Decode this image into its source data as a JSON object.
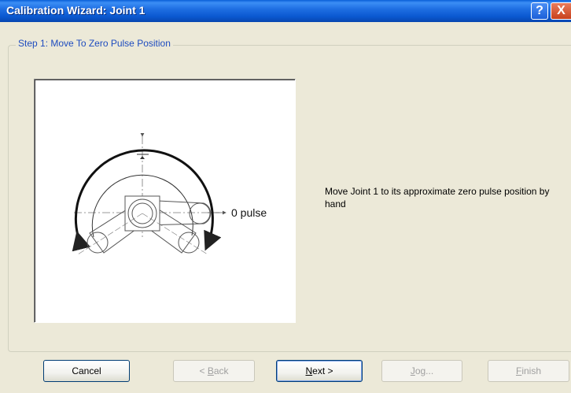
{
  "window": {
    "title": "Calibration Wizard: Joint 1",
    "help_glyph": "?",
    "close_glyph": "X"
  },
  "step": {
    "legend": "Step 1: Move To Zero Pulse Position"
  },
  "diagram": {
    "label": "0 pulse"
  },
  "instruction": {
    "text": "Move Joint 1 to its approximate zero pulse position by hand"
  },
  "buttons": {
    "cancel": {
      "label": "Cancel",
      "enabled": true
    },
    "back": {
      "prefix": "< ",
      "mnemonic": "B",
      "rest": "ack",
      "enabled": false
    },
    "next": {
      "mnemonic": "N",
      "rest": "ext >",
      "enabled": true
    },
    "jog": {
      "mnemonic": "J",
      "rest": "og...",
      "enabled": false
    },
    "finish": {
      "mnemonic": "F",
      "rest": "inish",
      "enabled": false
    }
  }
}
